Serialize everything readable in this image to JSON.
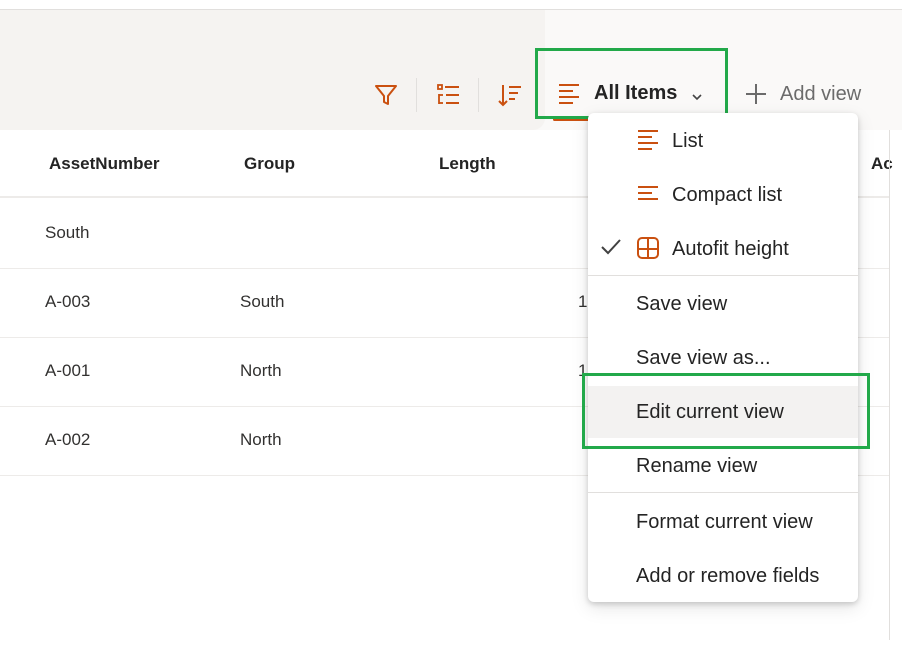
{
  "toolbar": {
    "filter_icon": "filter-icon",
    "group_icon": "group-list-icon",
    "sort_icon": "sort-icon",
    "view_selector": {
      "label": "All Items",
      "icon": "list-lines-icon",
      "chevron": "chevron-down-icon"
    },
    "add_view": {
      "label": "Add view",
      "icon": "plus-icon"
    },
    "accent_color": "#ca5010",
    "highlight_color": "#22a94a"
  },
  "table": {
    "columns": [
      "AssetNumber",
      "Group",
      "Length",
      "Ac"
    ],
    "rows": [
      {
        "asset": "South",
        "group": "",
        "length": ""
      },
      {
        "asset": "A-003",
        "group": "South",
        "length": "1"
      },
      {
        "asset": "A-001",
        "group": "North",
        "length": "1"
      },
      {
        "asset": "A-002",
        "group": "North",
        "length": ""
      }
    ]
  },
  "view_menu": {
    "items": [
      {
        "label": "List",
        "icon": "list-lines-icon",
        "checked": false
      },
      {
        "label": "Compact list",
        "icon": "compact-list-icon",
        "checked": false
      },
      {
        "label": "Autofit height",
        "icon": "grid-icon",
        "checked": true
      },
      {
        "label": "Save view"
      },
      {
        "label": "Save view as..."
      },
      {
        "label": "Edit current view",
        "highlighted": true
      },
      {
        "label": "Rename view"
      },
      {
        "label": "Format current view"
      },
      {
        "label": "Add or remove fields"
      }
    ]
  }
}
